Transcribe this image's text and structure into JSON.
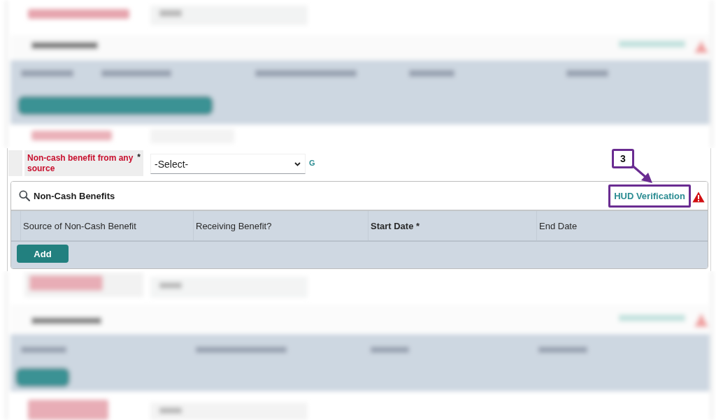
{
  "field": {
    "label": "Non-cash benefit from any source",
    "required_mark": "*",
    "select": {
      "value": "-Select-"
    },
    "code": "G"
  },
  "panel": {
    "title": "Non-Cash Benefits",
    "link": {
      "label": "HUD Verification",
      "highlighted": true
    },
    "columns": [
      {
        "label": "Source of Non-Cash Benefit",
        "required": false
      },
      {
        "label": "Receiving Benefit?",
        "required": false
      },
      {
        "label": "Start Date *",
        "required": true
      },
      {
        "label": "End Date",
        "required": false
      }
    ],
    "buttons": [
      "Add"
    ]
  },
  "callout": {
    "label": "3"
  }
}
